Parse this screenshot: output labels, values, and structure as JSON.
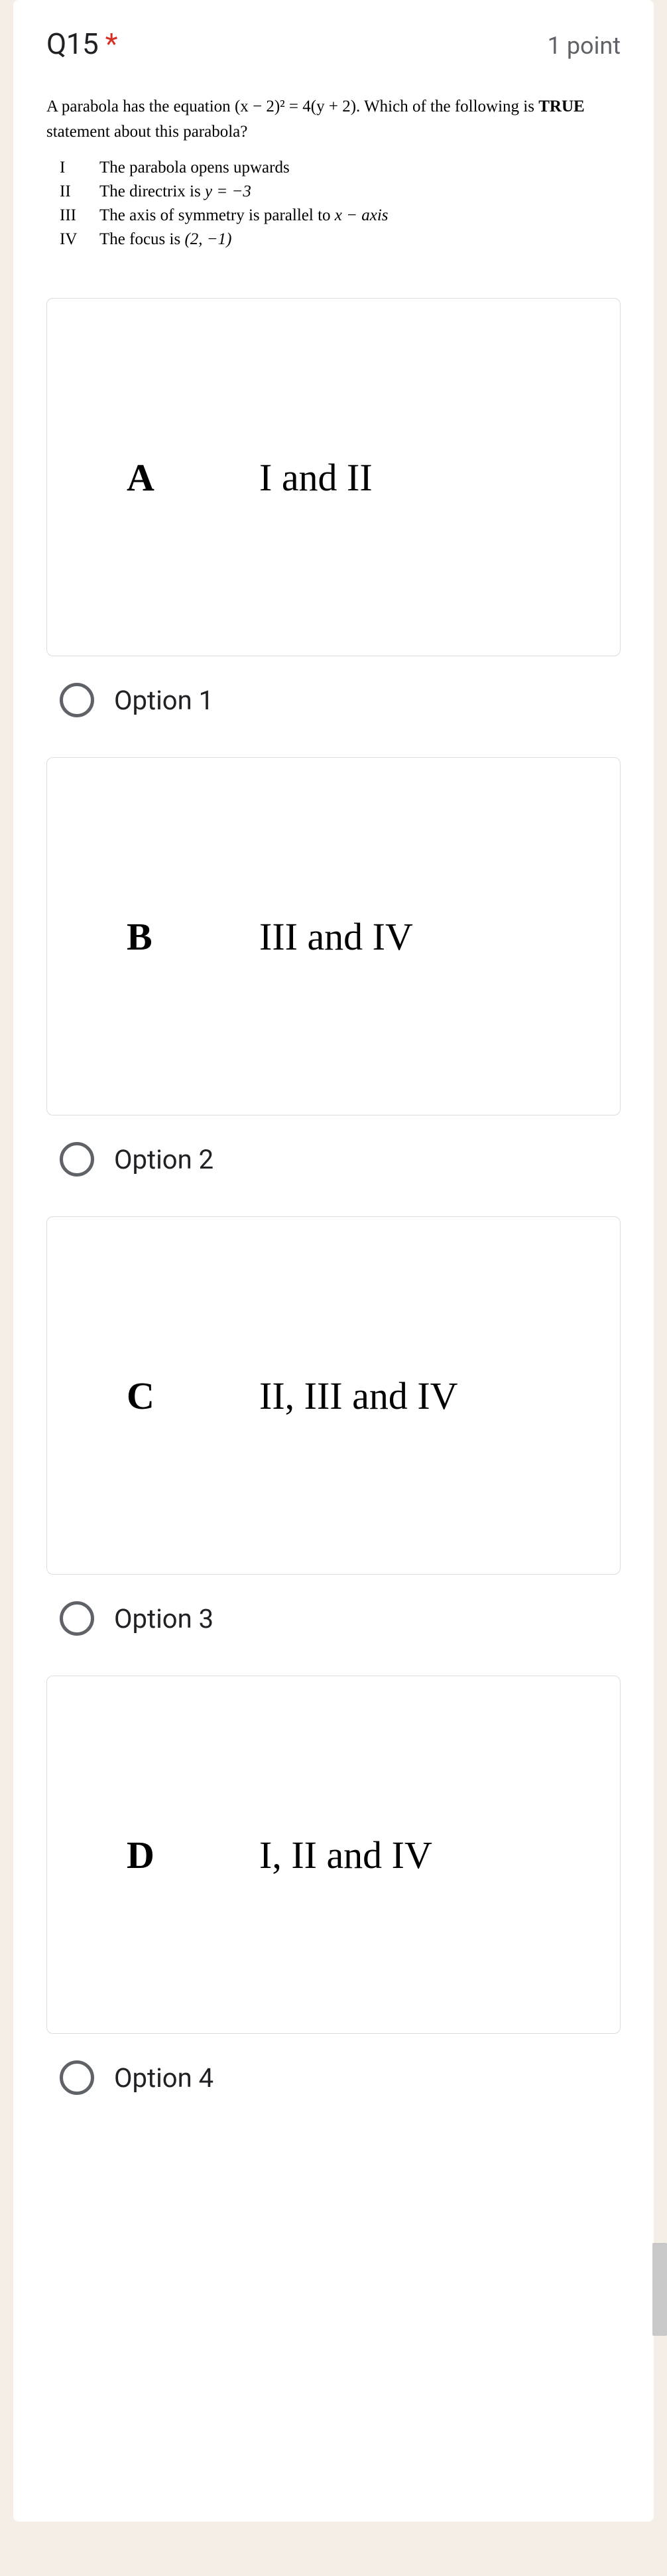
{
  "header": {
    "title": "Q15",
    "required_mark": "*",
    "points": "1 point"
  },
  "stem": {
    "intro_before": "A parabola has the equation ",
    "equation": "(x − 2)² = 4(y + 2)",
    "intro_after": ". Which of the following is ",
    "bold_word": "TRUE",
    "intro_end": " statement about this parabola?",
    "rows": [
      {
        "num": "I",
        "text": "The parabola opens upwards"
      },
      {
        "num": "II",
        "text_before": "The directrix is  ",
        "italic": "y = −3",
        "text_after": ""
      },
      {
        "num": "III",
        "text_before": "The axis of symmetry is parallel to  ",
        "italic": "x − axis",
        "text_after": ""
      },
      {
        "num": "IV",
        "text_before": "The focus is ",
        "italic": "(2, −1)",
        "text_after": ""
      }
    ]
  },
  "options": [
    {
      "letter": "A",
      "answer": "I and II",
      "label": "Option 1"
    },
    {
      "letter": "B",
      "answer": "III and IV",
      "label": "Option 2"
    },
    {
      "letter": "C",
      "answer": "II, III and IV",
      "label": "Option 3"
    },
    {
      "letter": "D",
      "answer": "I, II and IV",
      "label": "Option 4"
    }
  ]
}
